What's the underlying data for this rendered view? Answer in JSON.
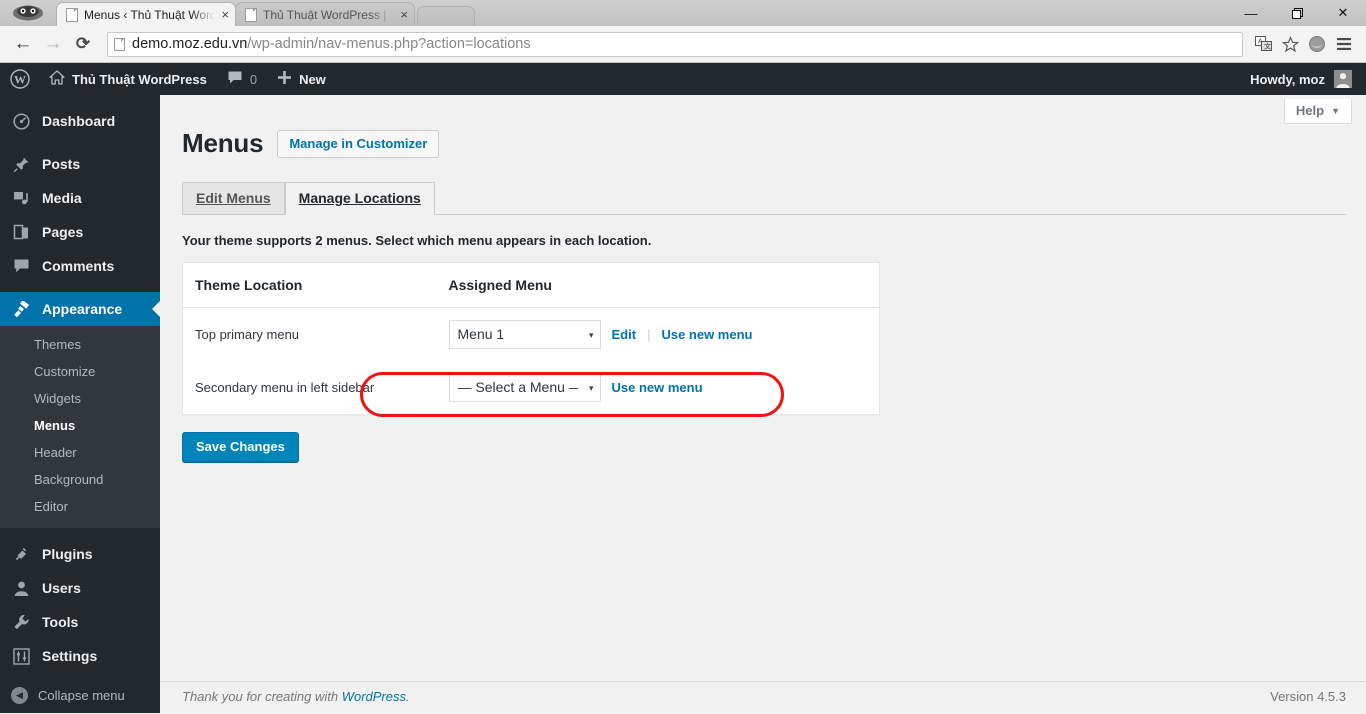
{
  "browser": {
    "tabs": [
      {
        "title": "Menus ‹ Thủ Thuật WordP",
        "active": true
      },
      {
        "title": "Thủ Thuật WordPress | Jus",
        "active": false
      }
    ],
    "close_glyph": "×",
    "window_controls": {
      "minimize": "—",
      "restore": "❐",
      "close": "✕"
    },
    "nav": {
      "back": "←",
      "forward": "→",
      "reload": "⟳"
    },
    "url": {
      "host": "demo.moz.edu.vn",
      "path": "/wp-admin/nav-menus.php?action=locations",
      "full": "demo.moz.edu.vn/wp-admin/nav-menus.php?action=locations"
    },
    "toolbar_icons": {
      "translate": "文",
      "bookmark": "☆",
      "profile": "◕",
      "menu": "☰"
    }
  },
  "adminbar": {
    "wp_logo": "wordpress-logo",
    "home_icon": "home-icon",
    "site_name": "Thủ Thuật WordPress",
    "comment_icon": "comment-icon",
    "comment_count": "0",
    "new_plus": "+",
    "new_label": "New",
    "howdy": "Howdy, moz"
  },
  "sidebar": {
    "items": [
      {
        "label": "Dashboard",
        "icon": "dashboard-icon",
        "current": false
      },
      {
        "label": "Posts",
        "icon": "pin-icon",
        "current": false
      },
      {
        "label": "Media",
        "icon": "media-icon",
        "current": false
      },
      {
        "label": "Pages",
        "icon": "pages-icon",
        "current": false
      },
      {
        "label": "Comments",
        "icon": "comment-icon",
        "current": false
      },
      {
        "label": "Appearance",
        "icon": "paintbrush-icon",
        "current": true
      },
      {
        "label": "Plugins",
        "icon": "plug-icon",
        "current": false
      },
      {
        "label": "Users",
        "icon": "user-icon",
        "current": false
      },
      {
        "label": "Tools",
        "icon": "wrench-icon",
        "current": false
      },
      {
        "label": "Settings",
        "icon": "sliders-icon",
        "current": false
      }
    ],
    "submenu": [
      {
        "label": "Themes",
        "current": false
      },
      {
        "label": "Customize",
        "current": false
      },
      {
        "label": "Widgets",
        "current": false
      },
      {
        "label": "Menus",
        "current": true
      },
      {
        "label": "Header",
        "current": false
      },
      {
        "label": "Background",
        "current": false
      },
      {
        "label": "Editor",
        "current": false
      }
    ],
    "collapse_label": "Collapse menu",
    "collapse_icon": "chevron-left-icon"
  },
  "page": {
    "help_label": "Help",
    "help_caret": "▼",
    "title": "Menus",
    "customizer_button": "Manage in Customizer",
    "tabs": [
      {
        "label": "Edit Menus",
        "active": false
      },
      {
        "label": "Manage Locations",
        "active": true
      }
    ],
    "description": "Your theme supports 2 menus. Select which menu appears in each location.",
    "table": {
      "headers": [
        "Theme Location",
        "Assigned Menu"
      ],
      "rows": [
        {
          "location": "Top primary menu",
          "selected_menu": "Menu 1",
          "options": [
            "— Select a Menu —",
            "Menu 1"
          ],
          "links": [
            "Edit",
            "Use new menu"
          ],
          "highlighted": true
        },
        {
          "location": "Secondary menu in left sidebar",
          "selected_menu": "— Select a Menu —",
          "options": [
            "— Select a Menu —",
            "Menu 1"
          ],
          "links": [
            "Use new menu"
          ],
          "highlighted": false
        }
      ]
    },
    "save_button": "Save Changes",
    "caret_glyph": "▾"
  },
  "footer": {
    "thanks_prefix": "Thank you for creating with ",
    "wordpress_link": "WordPress",
    "thanks_suffix": ".",
    "version": "Version 4.5.3"
  },
  "colors": {
    "wp_blue": "#0073aa",
    "button_blue": "#0085ba",
    "admin_dark": "#23282d",
    "submenu_dark": "#32373c",
    "annotation_red": "#f51010"
  }
}
